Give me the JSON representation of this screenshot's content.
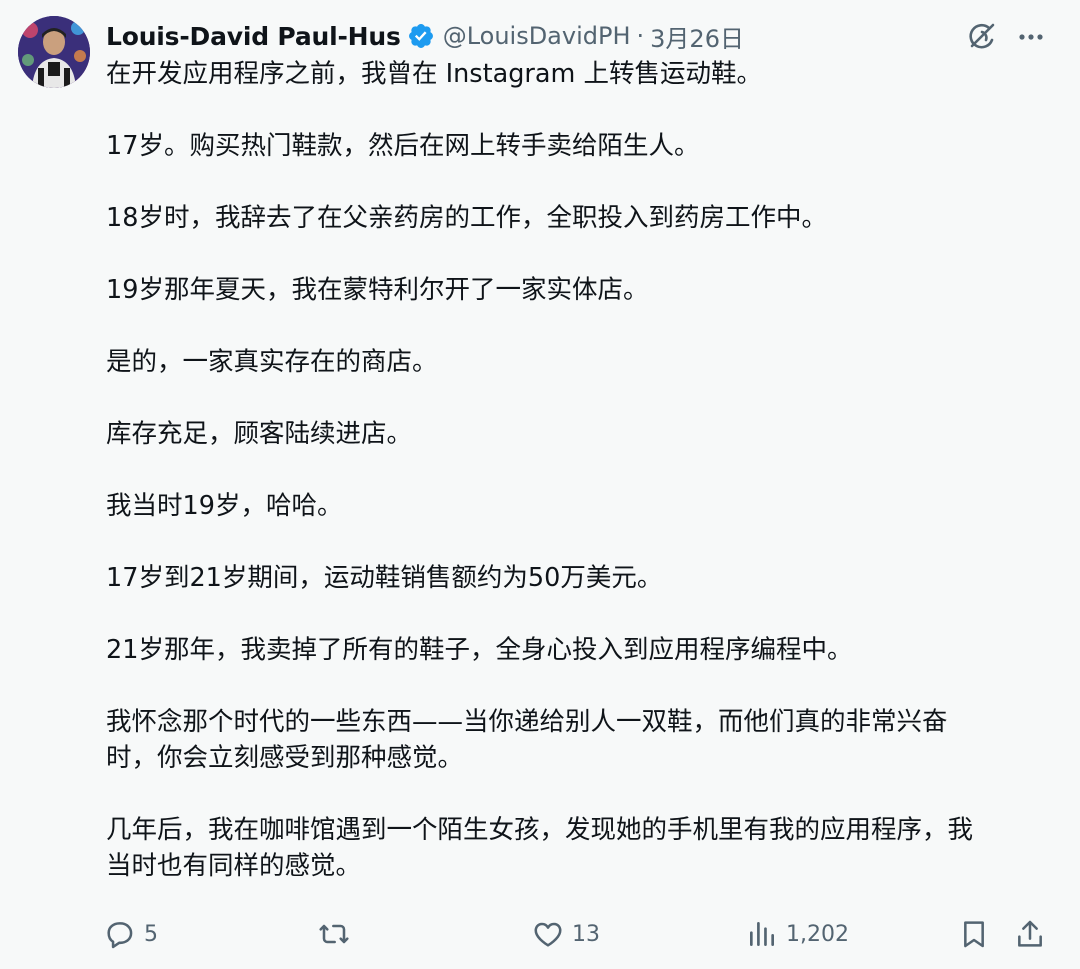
{
  "tweet": {
    "author_name": "Louis-David Paul-Hus",
    "handle": "@LouisDavidPH",
    "separator": "·",
    "date": "3月26日",
    "paragraphs": [
      "在开发应用程序之前，我曾在 Instagram 上转售运动鞋。",
      "17岁。购买热门鞋款，然后在网上转手卖给陌生人。",
      "18岁时，我辞去了在父亲药房的工作，全职投入到药房工作中。",
      "19岁那年夏天，我在蒙特利尔开了一家实体店。",
      "是的，一家真实存在的商店。",
      "库存充足，顾客陆续进店。",
      "我当时19岁，哈哈。",
      "17岁到21岁期间，运动鞋销售额约为50万美元。",
      "21岁那年，我卖掉了所有的鞋子，全身心投入到应用程序编程中。",
      "我怀念那个时代的一些东西——当你递给别人一双鞋，而他们真的非常兴奋\n时，你会立刻感受到那种感觉。",
      "几年后，我在咖啡馆遇到一个陌生女孩，发现她的手机里有我的应用程序，我\n当时也有同样的感觉。"
    ],
    "icons": {
      "verified": "verified-badge-icon",
      "grok": "grok-icon",
      "more": "more-icon",
      "reply": "reply-icon",
      "retweet": "retweet-icon",
      "like": "heart-icon",
      "views": "views-icon",
      "bookmark": "bookmark-icon",
      "share": "share-icon"
    },
    "counts": {
      "replies": "5",
      "likes": "13",
      "views": "1,202"
    },
    "colors": {
      "verified": "#1d9bf0",
      "text": "#0f1419",
      "secondary": "#536471",
      "background": "#f7f9f9"
    }
  }
}
